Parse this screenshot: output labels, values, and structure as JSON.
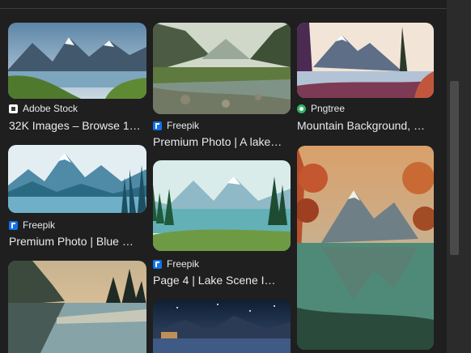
{
  "results": [
    {
      "source": "Adobe Stock",
      "source_icon": "adobe-stock-icon",
      "title": "32K Images – Browse 13,…"
    },
    {
      "source": "Freepik",
      "source_icon": "freepik-icon",
      "title": "Premium Photo | A lake…"
    },
    {
      "source": "Pngtree",
      "source_icon": "pngtree-icon",
      "title": "Mountain Background, …"
    },
    {
      "source": "Freepik",
      "source_icon": "freepik-icon",
      "title": "Premium Photo | Blue m…"
    },
    {
      "source": "Freepik",
      "source_icon": "freepik-icon",
      "title": "Page 4 | Lake Scene I…"
    }
  ],
  "colors": {
    "background": "#1f1f1f",
    "text": "#e8eaed",
    "freepik": "#1273eb",
    "pngtree": "#35b36a"
  }
}
